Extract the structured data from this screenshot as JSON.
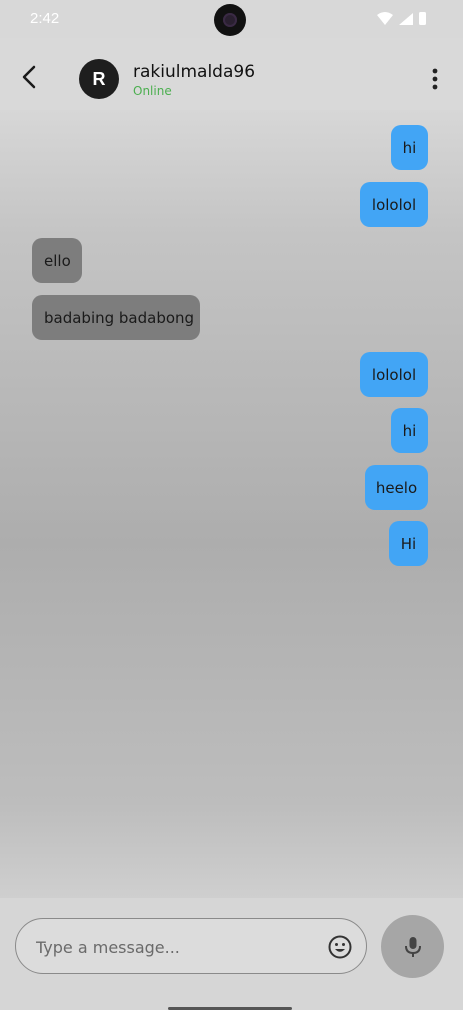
{
  "status_bar": {
    "time": "2:42"
  },
  "header": {
    "avatar_initial": "R",
    "contact_name": "rakiulmalda96",
    "contact_status": "Online"
  },
  "messages": [
    {
      "text": "hi",
      "direction": "outgoing"
    },
    {
      "text": "lololol",
      "direction": "outgoing"
    },
    {
      "text": "ello",
      "direction": "incoming"
    },
    {
      "text": "badabing badabong",
      "direction": "incoming"
    },
    {
      "text": "lololol",
      "direction": "outgoing"
    },
    {
      "text": "hi",
      "direction": "outgoing"
    },
    {
      "text": "heelo",
      "direction": "outgoing"
    },
    {
      "text": "Hi",
      "direction": "outgoing"
    }
  ],
  "composer": {
    "placeholder": "Type a message...",
    "value": ""
  },
  "icons": {
    "back": "back-arrow-icon",
    "more": "more-vert-icon",
    "emoji": "emoji-icon",
    "mic": "mic-icon"
  },
  "colors": {
    "outgoing_bubble": "#42a5f5",
    "incoming_bubble": "#7d7d7d",
    "online_status": "#4caf50"
  }
}
